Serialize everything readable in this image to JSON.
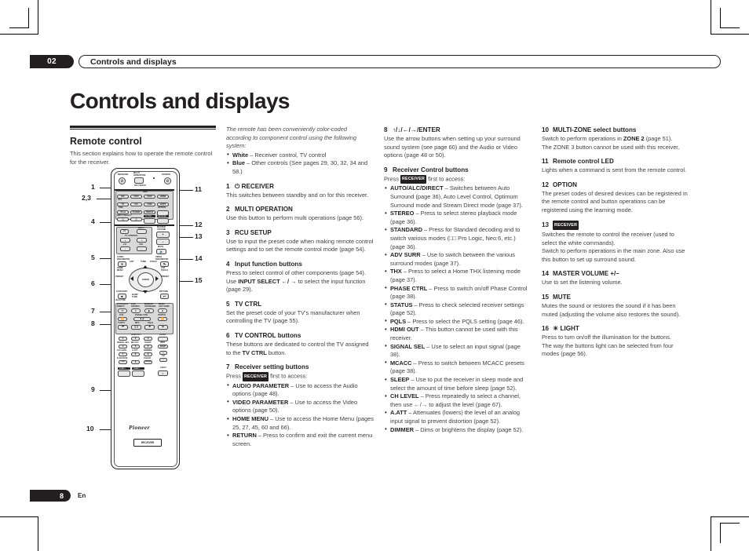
{
  "header": {
    "chapter": "02",
    "running_title": "Controls and displays"
  },
  "page_title": "Controls and displays",
  "footer": {
    "page_number": "8",
    "language": "En"
  },
  "col1": {
    "section_heading": "Remote control",
    "intro": "This section explains how to operate the remote control for the receiver."
  },
  "col2": {
    "italic_intro": "The remote has been conveniently color-coded according to component control using the following system:",
    "bullets": [
      {
        "term": "White",
        "text": " – Receiver control, TV control"
      },
      {
        "term": "Blue",
        "text": " – Other controls (See pages 29, 30, 32, 34 and 58.)"
      }
    ],
    "items": [
      {
        "num": "1",
        "title": "⏻ RECEIVER",
        "body": "This switches between standby and on for this receiver."
      },
      {
        "num": "2",
        "title": "MULTI OPERATION",
        "body": "Use this button to perform multi operations (page 56)."
      },
      {
        "num": "3",
        "title": "RCU SETUP",
        "body": "Use to input the preset code when making remote control settings and to set the remote control mode (page 54)."
      },
      {
        "num": "4",
        "title": "Input function buttons",
        "body": "Press to select control of other components (page 54).",
        "body2_pre": "Use ",
        "body2_bold": "INPUT SELECT ",
        "body2_arrows": "←/ →",
        "body2_post": " to select the input function (page 29)."
      },
      {
        "num": "5",
        "title": "TV CTRL",
        "body": "Set the preset code of your TV's manufacturer when controlling the TV (page 55)."
      },
      {
        "num": "6",
        "title": "TV CONTROL buttons",
        "body_pre": "These buttons are dedicated to control the TV assigned to the ",
        "body_bold": "TV CTRL",
        "body_post": " button."
      },
      {
        "num": "7",
        "title": "Receiver setting buttons",
        "press_pre": "Press ",
        "press_tag": "RECEIVER",
        "press_post": " first to access:",
        "bullets": [
          {
            "term": "AUDIO PARAMETER",
            "text": " – Use to access the Audio options (page 48)."
          },
          {
            "term": "VIDEO PARAMETER",
            "text": " – Use to access the Video options (page 50)."
          },
          {
            "term": "HOME MENU",
            "text": " – Use to access the Home Menu (pages 25, 27, 45, 60 and 66)."
          },
          {
            "term": "RETURN",
            "text": " – Press to confirm and exit the current menu screen."
          }
        ]
      }
    ]
  },
  "col3": {
    "items": [
      {
        "num": "8",
        "title": "↑/↓/←/→/ENTER",
        "body": "Use the arrow buttons when setting up your surround sound system (see page 60) and the Audio or Video options (page 48 or 50)."
      },
      {
        "num": "9",
        "title": "Receiver Control buttons",
        "press_pre": "Press ",
        "press_tag": "RECEIVER",
        "press_post": " first to access:",
        "bullets": [
          {
            "term": "AUTO/ALC/DIRECT",
            "text": " – Switches between Auto Surround (page 36), Auto Level Control, Optimum Surround mode and Stream Direct mode (page 37)."
          },
          {
            "term": "STEREO",
            "text": " – Press to select stereo playback mode (page 36)."
          },
          {
            "term": "STANDARD",
            "text": " – Press for Standard decoding and to switch various modes (□□ Pro Logic, Neo:6, etc.) (page 36)."
          },
          {
            "term": "ADV SURR",
            "text": " – Use to switch between the various surround modes (page 37)."
          },
          {
            "term": "THX",
            "text": " – Press to select a Home THX listening mode (page 37)."
          },
          {
            "term": "PHASE CTRL",
            "text": " – Press to switch on/off Phase Control (page 38)."
          },
          {
            "term": "STATUS",
            "text": " – Press to check selected receiver settings (page 52)."
          },
          {
            "term": "PQLS",
            "text": " – Press to select the PQLS setting (page 46)."
          },
          {
            "term": "HDMI OUT",
            "text": " – This button cannot be used with this receiver."
          },
          {
            "term": "SIGNAL SEL",
            "text": " – Use to select an input signal (page 38)."
          },
          {
            "term": "MCACC",
            "text": " – Press to switch between MCACC presets (page 38)."
          },
          {
            "term": "SLEEP",
            "text": " – Use to put the receiver in sleep mode and select the amount of time before sleep (page 52)."
          },
          {
            "term": "CH LEVEL",
            "text": " – Press repeatedly to select a channel, then use ←/→ to adjust the level (page 67)."
          },
          {
            "term": "A.ATT",
            "text": " – Attenuates (lowers) the level of an analog input signal to prevent distortion (page 52)."
          },
          {
            "term": "DIMMER",
            "text": " – Dims or brightens the display (page 52)."
          }
        ]
      }
    ]
  },
  "col4": {
    "items": [
      {
        "num": "10",
        "title": "MULTI-ZONE select buttons",
        "body_pre": "Switch to perform operations in ",
        "body_bold": "ZONE 2",
        "body_post": " (page 51).",
        "body2": "The ZONE 3 button cannot be used with this receiver."
      },
      {
        "num": "11",
        "title": "Remote control LED",
        "body": "Lights when a command is sent from the remote control."
      },
      {
        "num": "12",
        "title": "OPTION",
        "body": "The preset codes of desired devices can be registered in the remote control and button operations can be registered using the learning mode."
      },
      {
        "num": "13",
        "title_tag": "RECEIVER",
        "body": "Switches the remote to control the receiver (used to select the white commands).",
        "body2": "Switch to perform operations in the main zone. Also use this button to set up surround sound."
      },
      {
        "num": "14",
        "title": "MASTER VOLUME +/–",
        "body": "Use to set the listening volume."
      },
      {
        "num": "15",
        "title": "MUTE",
        "body": "Mutes the sound or restores the sound if it has been muted (adjusting the volume also restores the sound)."
      },
      {
        "num": "16",
        "title": "☀ LIGHT",
        "body": "Press to turn on/off the illumination for the buttons.",
        "body2": "The way the buttons light can be selected from four modes (page 56)."
      }
    ]
  },
  "remote": {
    "brand": "Pioneer",
    "brand_badge": "RECEIVER",
    "callouts_left": [
      "1",
      "2,3",
      "4",
      "5",
      "6",
      "7",
      "8",
      "9",
      "10"
    ],
    "callouts_right": [
      "11",
      "12",
      "13",
      "14",
      "15"
    ],
    "labels": {
      "receiver": "RECEIVER",
      "multi_operation": "MULTI OPERATION",
      "source": "SOURCE",
      "rcu_setup": "RCU SETUP",
      "bdr": "BDR",
      "sat": "SAT",
      "usb": "USB",
      "input_select": "INPUT SELECT",
      "option": "OPTION",
      "tv_ctrl": "TV CTRL",
      "zone2_top": "MULTI-ZONE",
      "tv_control": "TV CONTROL",
      "input": "INPUT",
      "master_volume": "MASTER VOLUME",
      "mute": "MUTE",
      "ch": "CH",
      "vol": "VOL",
      "audio_parameter": "AUDIO PARAMETER",
      "video_parameter": "VIDEO PARAMETER",
      "home_menu": "HOME MENU",
      "return": "RETURN",
      "enter": "ENTER",
      "preset": "PRESET",
      "tune": "TUNE",
      "list": "LIST",
      "tools": "TOOLS",
      "category": "CATEGORY",
      "ipod_ctrl": "iPod CTRL",
      "auto_alc_direct": "AUTO/ALC/ DIRECT",
      "stereo": "STEREO",
      "standard": "STANDARD",
      "adv_surr": "ADV SURR",
      "thx": "THX",
      "phase_ctrl": "PHASE CTRL",
      "status": "STATUS",
      "tv_dtv": "TV/DTV",
      "mpx": "MPX",
      "pqls": "PQLS",
      "hdmi_out": "HDMI OUT",
      "audio": "AUDIO",
      "signal_sel": "SIGNAL SEL",
      "mcacc": "MCACC",
      "sleep": "SLEEP",
      "info": "INFO",
      "disp": "DISP",
      "ch_level": "CH LEVEL",
      "a_att": "A.ATT",
      "dimmer": "DIMMER",
      "d_access": "D.ACCESS",
      "clear": "CLEAR",
      "zone2": "ZONE 2",
      "zone3": "ZONE 3",
      "light": "LIGHT",
      "bd": "BD",
      "dvd": "DVD",
      "dvr": "DVR",
      "hdmi": "HDMI",
      "tv": "TV",
      "cd": "CD",
      "cdr": "CDR",
      "adpt": "ADPT",
      "ipod": "iPod",
      "tuner": "TUNER",
      "sirius": "SIRIUS",
      "keys": [
        "1",
        "2",
        "3",
        "4",
        "5",
        "6",
        "7",
        "8",
        "9",
        "0"
      ]
    }
  }
}
